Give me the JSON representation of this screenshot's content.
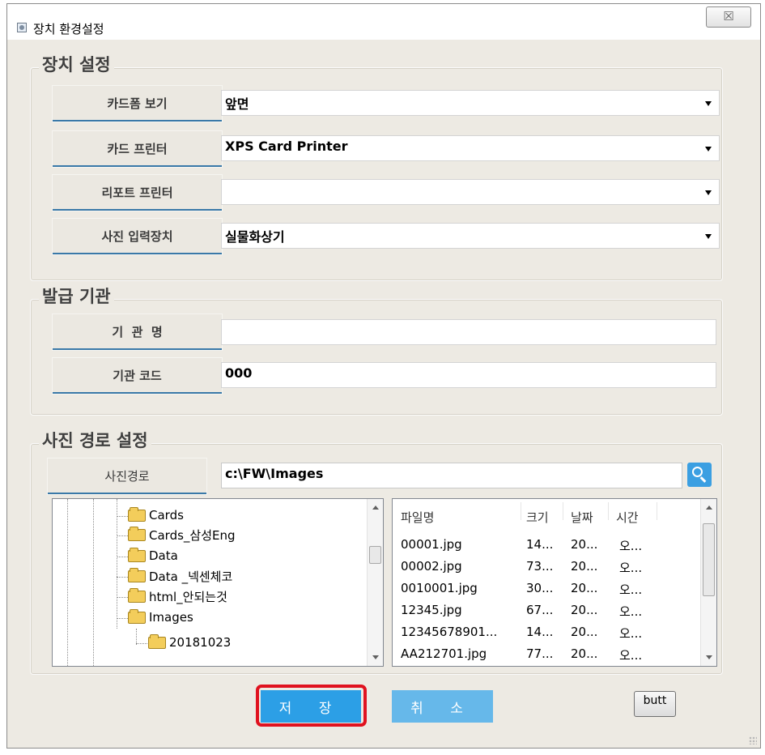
{
  "window": {
    "title": "장치 환경설정",
    "close_glyph": "☒"
  },
  "device_settings": {
    "group_label": "장치 설정",
    "rows": [
      {
        "label": "카드폼 보기",
        "value": "앞면"
      },
      {
        "label": "카드 프린터",
        "value": "XPS Card Printer"
      },
      {
        "label": "리포트 프린터",
        "value": ""
      },
      {
        "label": "사진 입력장치",
        "value": "실물화상기"
      }
    ]
  },
  "issuer": {
    "group_label": "발급 기관",
    "name_label": "기  관  명",
    "name_value": "",
    "code_label": "기관 코드",
    "code_value": "000"
  },
  "photo_path": {
    "group_label": "사진 경로 설정",
    "path_label": "사진경로",
    "path_value": "c:\\FW\\Images",
    "search_icon": "search-icon"
  },
  "tree": {
    "items": [
      {
        "name": "Cards"
      },
      {
        "name": "Cards_삼성Eng"
      },
      {
        "name": "Data"
      },
      {
        "name": "Data _넥센체코"
      },
      {
        "name": "html_안되는것"
      },
      {
        "name": "Images"
      },
      {
        "name": "20181023"
      }
    ]
  },
  "file_list": {
    "columns": [
      "파일명",
      "크기",
      "날짜",
      "시간"
    ],
    "rows": [
      [
        "00001.jpg",
        "14...",
        "20...",
        "오..."
      ],
      [
        "00002.jpg",
        "73...",
        "20...",
        "오..."
      ],
      [
        "0010001.jpg",
        "30...",
        "20...",
        "오..."
      ],
      [
        "12345.jpg",
        "67...",
        "20...",
        "오..."
      ],
      [
        "12345678901...",
        "14...",
        "20...",
        "오..."
      ],
      [
        "AA212701.jpg",
        "77...",
        "20...",
        "오..."
      ]
    ]
  },
  "buttons": {
    "save": "저 장",
    "cancel": "취 소",
    "extra": "butt"
  },
  "colors": {
    "accent": "#2c9fe6",
    "highlight": "#e0121f",
    "label_underline": "#3a79a8"
  }
}
